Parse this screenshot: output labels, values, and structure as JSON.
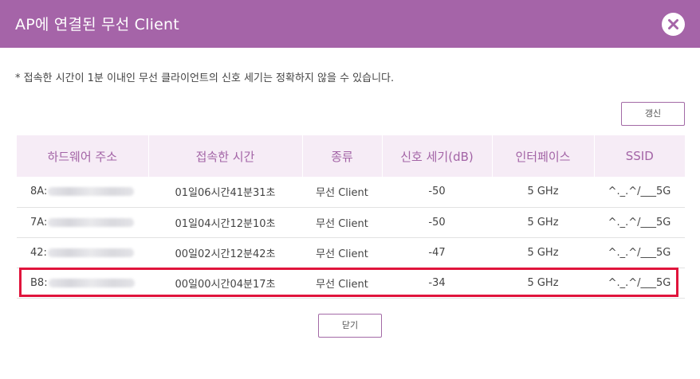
{
  "dialog": {
    "title": "AP에 연결된 무선 Client",
    "notice": "* 접속한 시간이 1분 이내인 무선 클라이언트의 신호 세기는 정확하지 않을 수 있습니다.",
    "refresh_label": "갱신",
    "close_label": "닫기"
  },
  "table": {
    "headers": [
      "하드웨어 주소",
      "접속한 시간",
      "종류",
      "신호 세기(dB)",
      "인터페이스",
      "SSID"
    ],
    "rows": [
      {
        "mac": "8A:",
        "time": "01일06시간41분31초",
        "type": "무선 Client",
        "signal": "-50",
        "iface": "5 GHz",
        "ssid": "^._.^/___5G"
      },
      {
        "mac": "7A:",
        "time": "01일04시간12분10초",
        "type": "무선 Client",
        "signal": "-50",
        "iface": "5 GHz",
        "ssid": "^._.^/___5G"
      },
      {
        "mac": "42:",
        "time": "00일02시간12분42초",
        "type": "무선 Client",
        "signal": "-47",
        "iface": "5 GHz",
        "ssid": "^._.^/___5G"
      },
      {
        "mac": "B8:",
        "time": "00일00시간04분17초",
        "type": "무선 Client",
        "signal": "-34",
        "iface": "5 GHz",
        "ssid": "^._.^/___5G"
      }
    ]
  },
  "colors": {
    "header_bar": "#a564a8",
    "table_header_bg": "#f6ecf6",
    "table_header_text": "#a364a6",
    "highlight_border": "#e0143c"
  },
  "icons": {
    "close": "close-x-icon"
  }
}
